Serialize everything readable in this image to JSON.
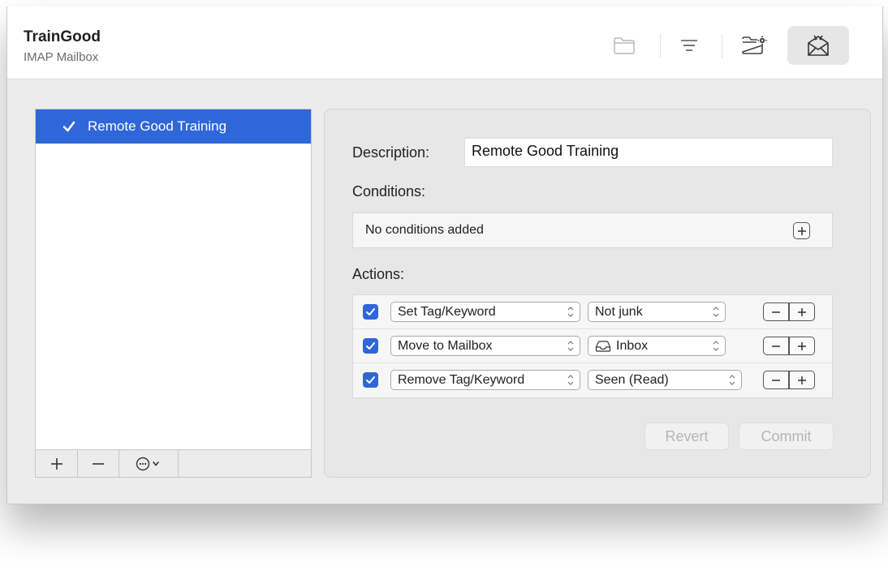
{
  "header": {
    "title": "TrainGood",
    "subtitle": "IMAP Mailbox",
    "toolbar_icons": [
      "folder-icon",
      "filter-lines-icon",
      "folder-gear-icon",
      "mail-rules-icon"
    ],
    "active_toolbar_icon": "mail-rules-icon"
  },
  "rules_list": {
    "items": [
      {
        "label": "Remote Good Training",
        "checked": true,
        "selected": true
      }
    ],
    "bottom_bar": {
      "add_icon": "plus-icon",
      "remove_icon": "minus-icon",
      "more_icon": "ellipsis-circle-icon"
    }
  },
  "editor": {
    "description_label": "Description:",
    "description_value": "Remote Good Training",
    "conditions_label": "Conditions:",
    "conditions_empty_text": "No conditions added",
    "actions_label": "Actions:",
    "actions": [
      {
        "checked": true,
        "action": "Set Tag/Keyword",
        "target": "Not junk",
        "target_icon": ""
      },
      {
        "checked": true,
        "action": "Move to Mailbox",
        "target": "Inbox",
        "target_icon": "inbox-tray-icon"
      },
      {
        "checked": true,
        "action": "Remove Tag/Keyword",
        "target": "Seen (Read)",
        "target_icon": ""
      }
    ],
    "revert_label": "Revert",
    "commit_label": "Commit"
  },
  "colors": {
    "accent": "#2f66d8",
    "window_bg": "#ececec",
    "disabled_text": "#b6b6b6"
  }
}
